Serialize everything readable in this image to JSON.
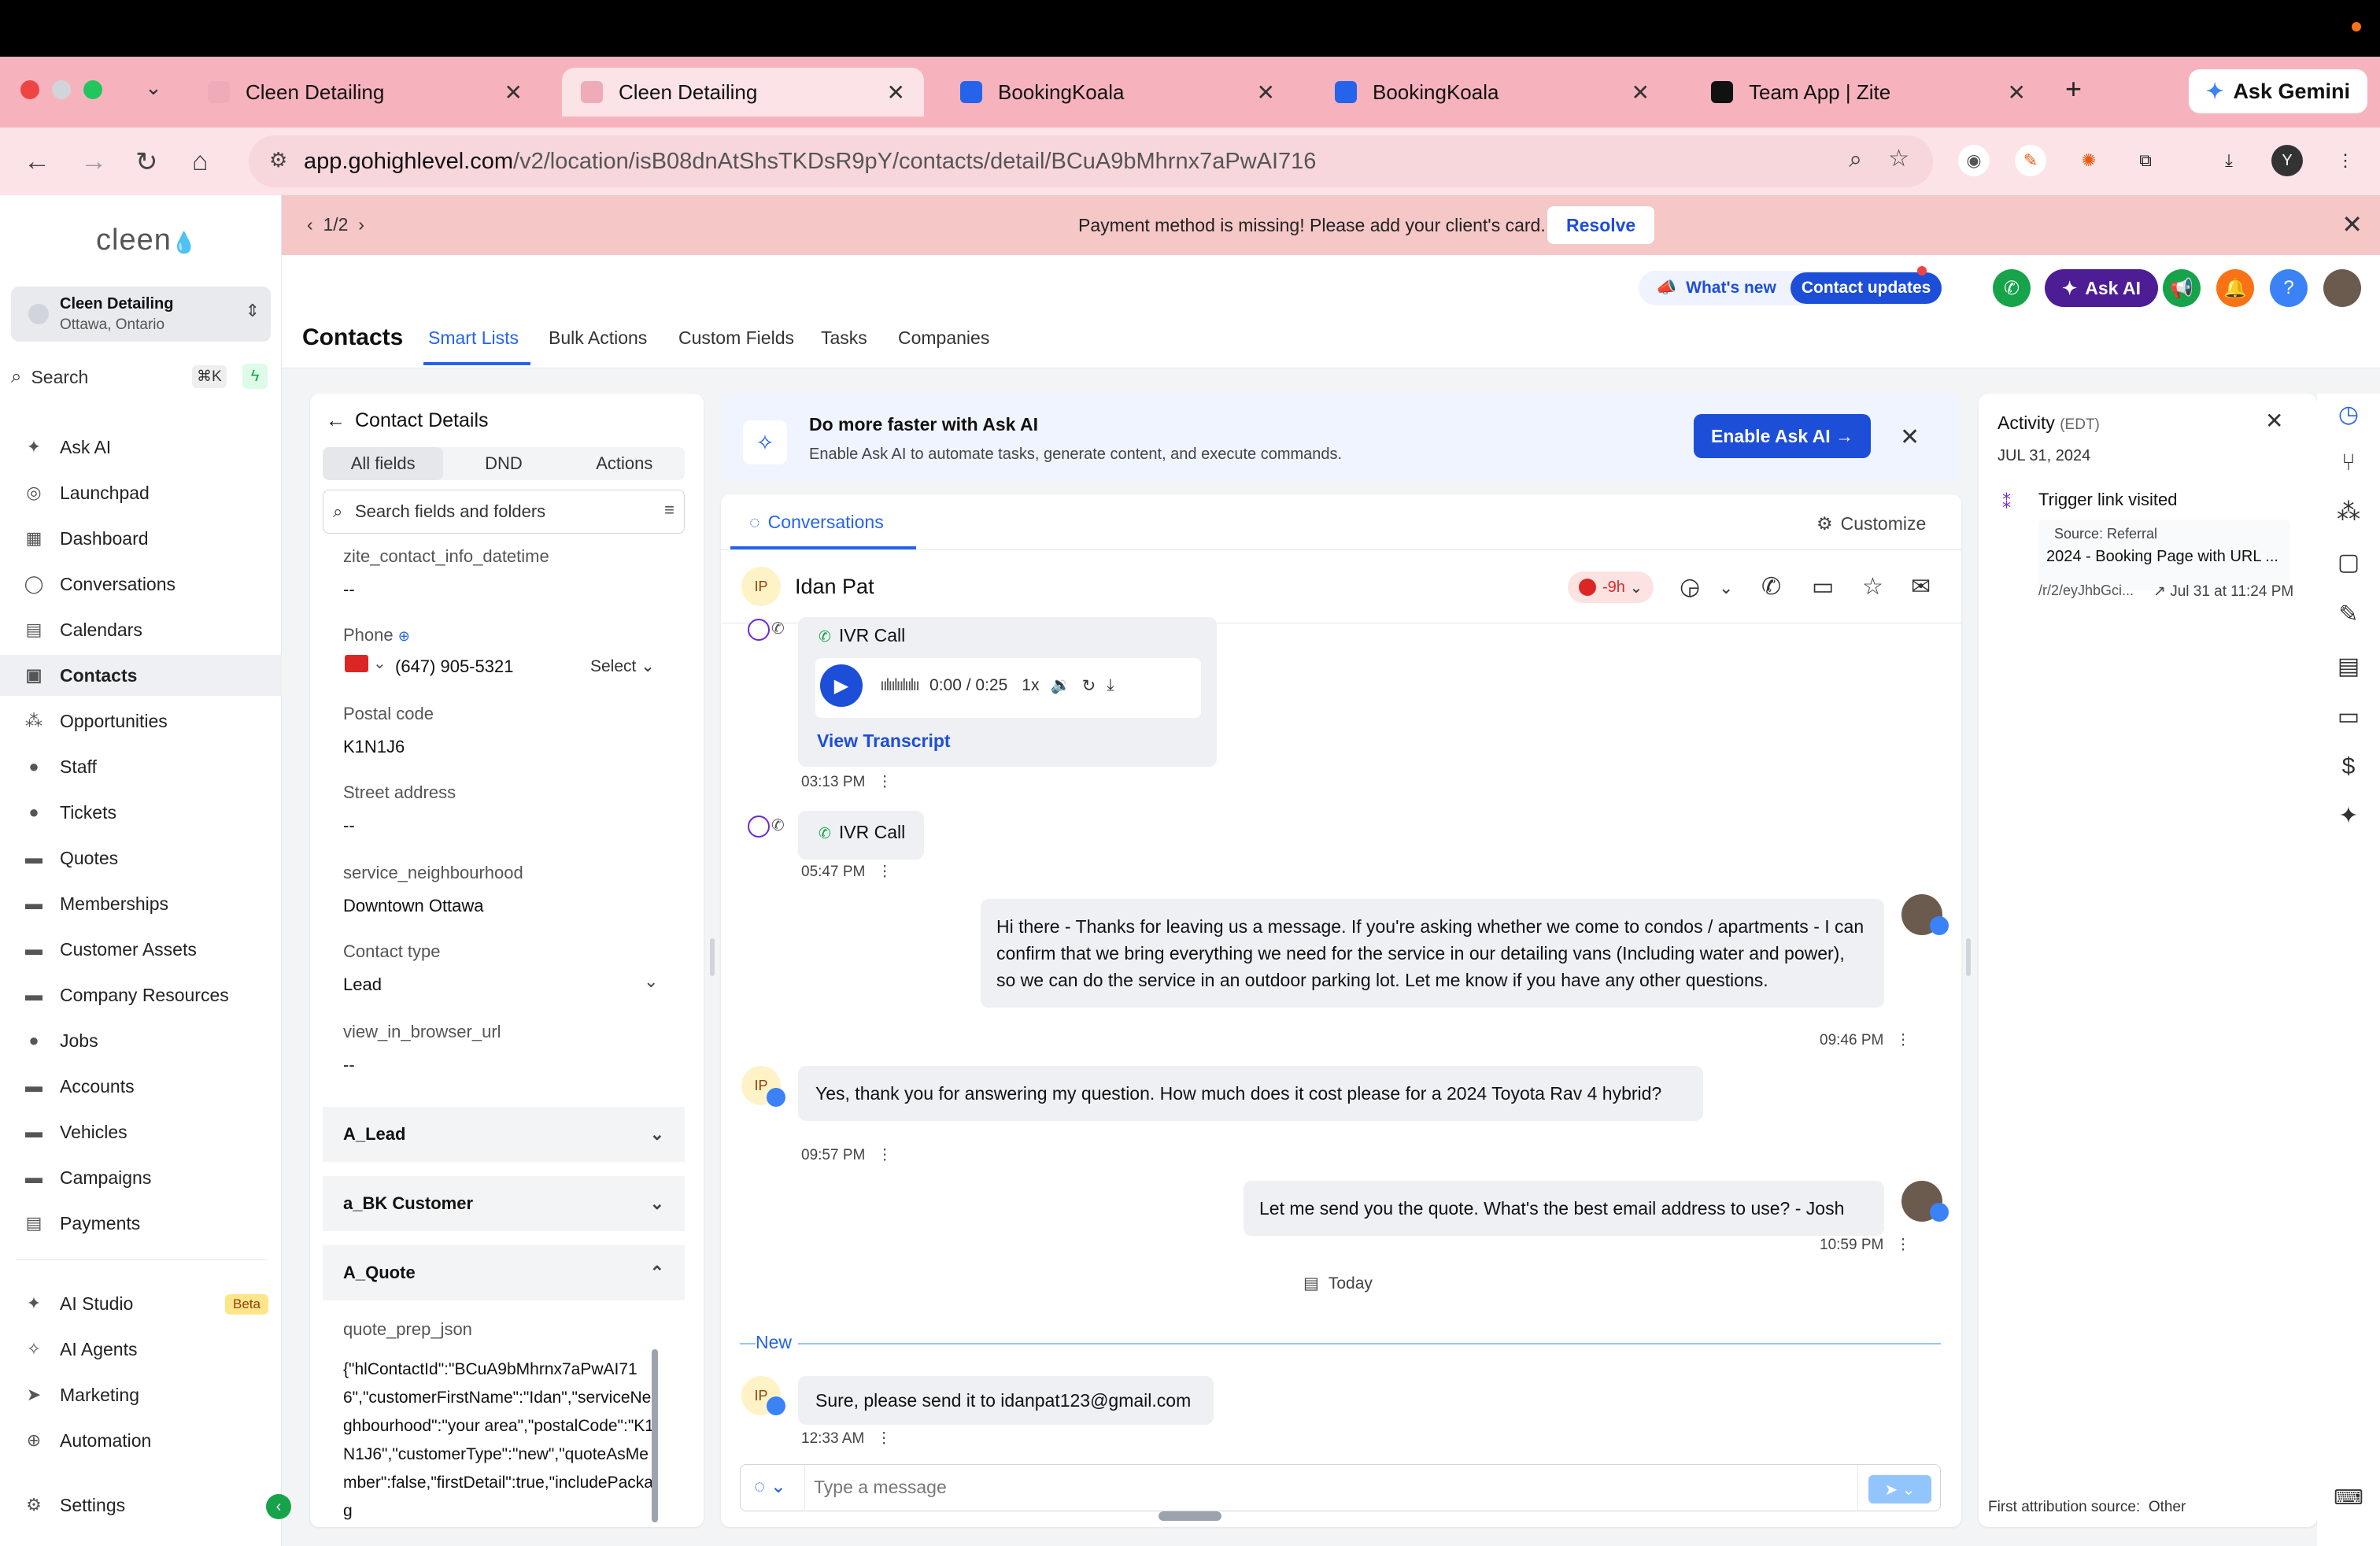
{
  "browser": {
    "tabs": [
      {
        "title": "Cleen Detailing",
        "active": false
      },
      {
        "title": "Cleen Detailing",
        "active": true
      },
      {
        "title": "BookingKoala",
        "active": false
      },
      {
        "title": "BookingKoala",
        "active": false
      },
      {
        "title": "Team App | Zite",
        "active": false
      }
    ],
    "gemini_label": "Ask Gemini",
    "url_host": "app.gohighlevel.com",
    "url_path": "/v2/location/isB08dnAtShsTKDsR9pY/contacts/detail/BCuA9bMhrnx7aPwAI716",
    "profile_initial": "Y"
  },
  "sidebar": {
    "logo": "cleen",
    "location_name": "Cleen Detailing",
    "location_sub": "Ottawa, Ontario",
    "search_label": "Search",
    "search_kbd": "⌘K",
    "items": [
      {
        "label": "Ask AI",
        "icon": "sparkle-icon"
      },
      {
        "label": "Launchpad",
        "icon": "launchpad-icon"
      },
      {
        "label": "Dashboard",
        "icon": "dashboard-icon"
      },
      {
        "label": "Conversations",
        "icon": "chat-icon"
      },
      {
        "label": "Calendars",
        "icon": "calendar-icon"
      },
      {
        "label": "Contacts",
        "icon": "contacts-icon"
      },
      {
        "label": "Opportunities",
        "icon": "opportunities-icon"
      },
      {
        "label": "Staff",
        "icon": "staff-icon"
      },
      {
        "label": "Tickets",
        "icon": "tickets-icon"
      },
      {
        "label": "Quotes",
        "icon": "quotes-icon"
      },
      {
        "label": "Memberships",
        "icon": "memberships-icon"
      },
      {
        "label": "Customer Assets",
        "icon": "assets-icon"
      },
      {
        "label": "Company Resources",
        "icon": "resources-icon"
      },
      {
        "label": "Jobs",
        "icon": "jobs-icon"
      },
      {
        "label": "Accounts",
        "icon": "accounts-icon"
      },
      {
        "label": "Vehicles",
        "icon": "vehicles-icon"
      },
      {
        "label": "Campaigns",
        "icon": "campaigns-icon"
      },
      {
        "label": "Payments",
        "icon": "payments-icon"
      }
    ],
    "bottom_items": [
      {
        "label": "AI Studio",
        "icon": "ai-studio-icon"
      },
      {
        "label": "AI Agents",
        "icon": "ai-agents-icon"
      },
      {
        "label": "Marketing",
        "icon": "marketing-icon"
      },
      {
        "label": "Automation",
        "icon": "automation-icon"
      },
      {
        "label": "Settings",
        "icon": "gear-icon"
      }
    ],
    "beta_label": "Beta"
  },
  "banner": {
    "pager": "1/2",
    "message": "Payment method is missing! Please add your client's card.",
    "resolve_label": "Resolve"
  },
  "header": {
    "title": "Contacts",
    "tabs": [
      "Smart Lists",
      "Bulk Actions",
      "Custom Fields",
      "Tasks",
      "Companies"
    ],
    "whats_new": "What's new",
    "contact_updates": "Contact updates",
    "ask_ai": "Ask AI"
  },
  "contact_details": {
    "title": "Contact Details",
    "tabs": [
      "All fields",
      "DND",
      "Actions"
    ],
    "search_placeholder": "Search fields and folders",
    "fields": [
      {
        "label": "zite_contact_info_datetime",
        "value": "--"
      },
      {
        "label": "Phone",
        "value": "(647) 905-5321"
      },
      {
        "label": "Postal code",
        "value": "K1N1J6"
      },
      {
        "label": "Street address",
        "value": "--"
      },
      {
        "label": "service_neighbourhood",
        "value": "Downtown Ottawa"
      },
      {
        "label": "Contact type",
        "value": "Lead"
      },
      {
        "label": "view_in_browser_url",
        "value": "--"
      }
    ],
    "phone_select": "Select",
    "sections": [
      "A_Lead",
      "a_BK Customer",
      "A_Quote"
    ],
    "json_label": "quote_prep_json",
    "json_value": "{\"hlContactId\":\"BCuA9bMhrnx7aPwAI716\",\"customerFirstName\":\"Idan\",\"serviceNeighbourhood\":\"your area\",\"postalCode\":\"K1N1J6\",\"customerType\":\"new\",\"quoteAsMember\":false,\"firstDetail\":true,\"includePackag"
  },
  "promo": {
    "title": "Do more faster with Ask AI",
    "subtitle": "Enable Ask AI to automate tasks, generate content, and execute commands.",
    "button": "Enable Ask AI →"
  },
  "conversation": {
    "tab": "Conversations",
    "customize": "Customize",
    "contact_name": "Idan Pat",
    "contact_initials": "IP",
    "dnd_badge": "-9h",
    "ivr_label": "IVR Call",
    "audio_time": "0:00 / 0:25",
    "audio_speed": "1x",
    "view_transcript": "View Transcript",
    "messages": [
      {
        "time": "03:13 PM"
      },
      {
        "time": "05:47 PM"
      },
      {
        "text": "Hi there - Thanks for leaving us a message. If you're asking whether we come to condos / apartments - I can confirm that we bring everything we need for the service in our detailing vans (Including water and power), so we can do the service in an outdoor parking lot. Let me know if you have any other questions.",
        "time": "09:46 PM"
      },
      {
        "text": "Yes, thank you for answering my question. How much does it cost please for a 2024 Toyota Rav 4 hybrid?",
        "time": "09:57 PM"
      },
      {
        "text": "Let me send you the quote. What's the best email address to use? - Josh",
        "time": "10:59 PM"
      },
      {
        "text": "Sure, please send it to idanpat123@gmail.com",
        "time": "12:33 AM"
      }
    ],
    "today_label": "Today",
    "new_label": "New",
    "composer_placeholder": "Type a message"
  },
  "activity": {
    "title": "Activity",
    "tz": "(EDT)",
    "date": "JUL 31, 2024",
    "event": "Trigger link visited",
    "source": "Source: Referral",
    "page": "2024 - Booking Page with URL ...",
    "url": "/r/2/eyJhbGci...",
    "when": "Jul 31 at 11:24 PM",
    "footer_label": "First attribution source:",
    "footer_value": "Other"
  },
  "colors": {
    "accent": "#2563eb",
    "banner_bg": "#f5c7c7",
    "tabbar_bg": "#f7b3bd",
    "ask_ai_purple": "#4c1d95"
  }
}
